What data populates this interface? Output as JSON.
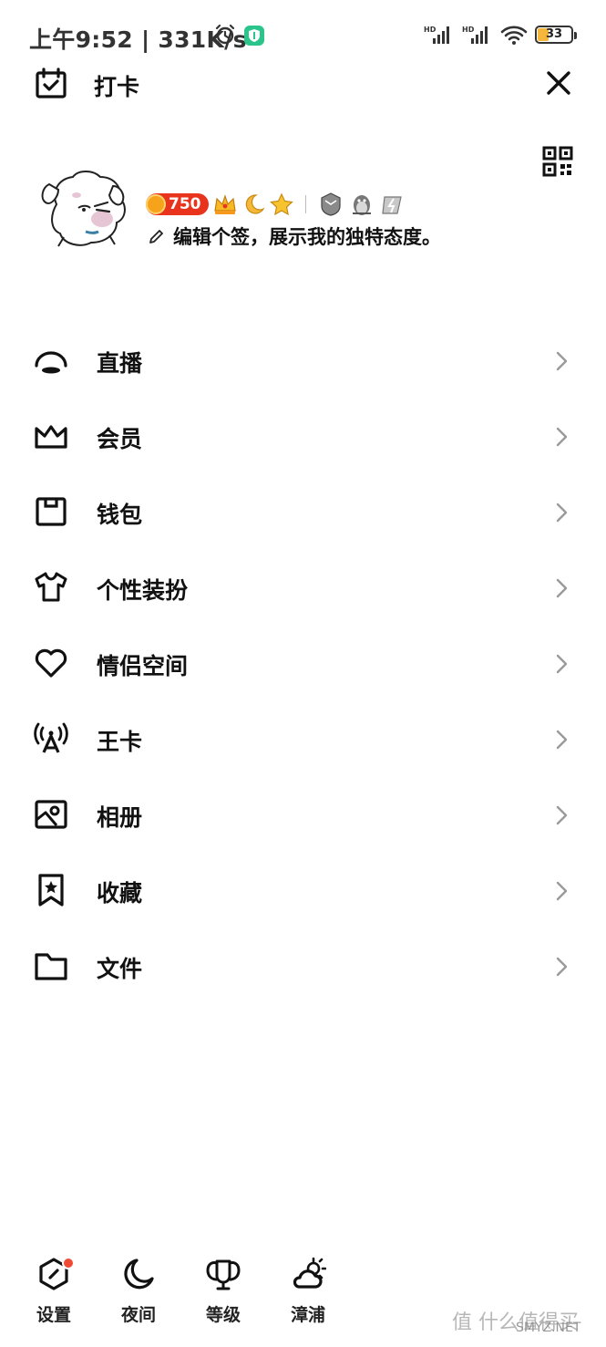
{
  "status_bar": {
    "time_speed": "上午9:52 | 331K/s",
    "hd1": "HD",
    "hd2": "HD",
    "battery": "33"
  },
  "header": {
    "checkin_label": "打卡"
  },
  "profile": {
    "coin_count": "750",
    "signature": "编辑个签，展示我的独特态度。"
  },
  "menu": [
    {
      "label": "直播",
      "icon": "live-icon"
    },
    {
      "label": "会员",
      "icon": "crown-icon"
    },
    {
      "label": "钱包",
      "icon": "wallet-icon"
    },
    {
      "label": "个性装扮",
      "icon": "tshirt-icon"
    },
    {
      "label": "情侣空间",
      "icon": "heart-icon"
    },
    {
      "label": "王卡",
      "icon": "signal-tower-icon"
    },
    {
      "label": "相册",
      "icon": "album-icon"
    },
    {
      "label": "收藏",
      "icon": "bookmark-star-icon"
    },
    {
      "label": "文件",
      "icon": "folder-icon"
    }
  ],
  "bottom_bar": [
    {
      "label": "设置",
      "icon": "settings-icon"
    },
    {
      "label": "夜间",
      "icon": "moon-icon"
    },
    {
      "label": "等级",
      "icon": "trophy-wings-icon"
    },
    {
      "label": "漳浦",
      "icon": "weather-cloud-icon"
    }
  ],
  "watermark": {
    "main": "值 什么值得买",
    "sub": "SMYZ.NET"
  },
  "colors": {
    "accent_red": "#f04a35",
    "coin_orange": "#f7a21b",
    "shield_green": "#2bc48a",
    "battery_yellow": "#f5b73b"
  }
}
